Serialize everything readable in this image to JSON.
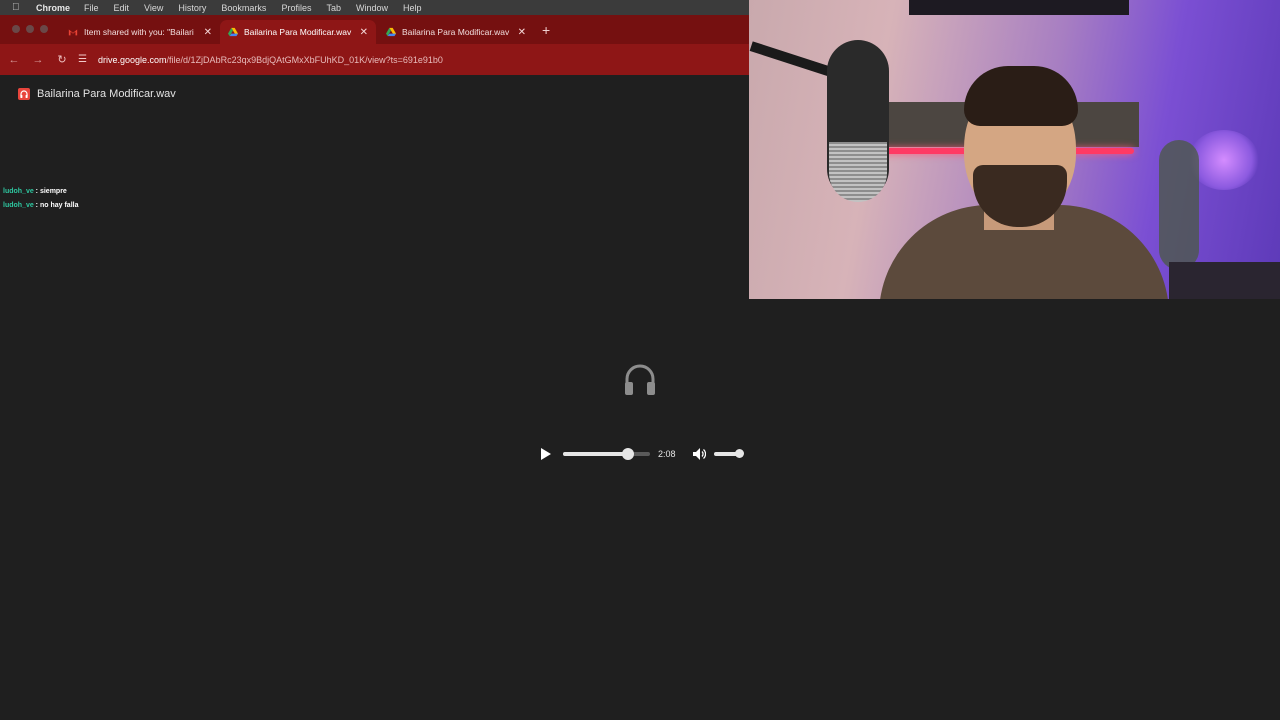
{
  "menubar": {
    "app": "Chrome",
    "items": [
      "File",
      "Edit",
      "View",
      "History",
      "Bookmarks",
      "Profiles",
      "Tab",
      "Window",
      "Help"
    ]
  },
  "browser": {
    "tabs": [
      {
        "title": "Item shared with you: \"Bailari",
        "icon": "gmail-icon",
        "active": false
      },
      {
        "title": "Bailarina Para Modificar.wav",
        "icon": "google-drive-icon",
        "active": true
      },
      {
        "title": "Bailarina Para Modificar.wav",
        "icon": "google-drive-icon",
        "active": false
      }
    ],
    "url_host": "drive.google.com",
    "url_path": "/file/d/1ZjDAbRc23qx9BdjQAtGMxXbFUhKD_01K/view?ts=691e91b0"
  },
  "viewer": {
    "file_name": "Bailarina Para Modificar.wav",
    "player": {
      "time": "2:08",
      "progress": 0.75,
      "volume": 1.0
    }
  },
  "chat": [
    {
      "user": "ludoh_ve",
      "message": "siempre"
    },
    {
      "user": "ludoh_ve",
      "message": "no hay falla"
    }
  ],
  "colors": {
    "tab_strip": "#751010",
    "toolbar": "#8e1616",
    "viewer_bg": "#1f1f1f",
    "chat_user": "#2ec7a0"
  }
}
